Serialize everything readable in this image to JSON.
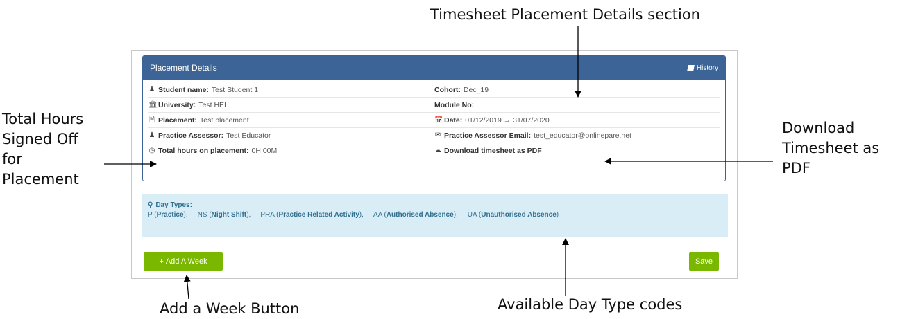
{
  "callouts": {
    "top": "Timesheet Placement Details section",
    "total_hours": [
      "Total Hours",
      "Signed Off",
      "for",
      "Placement"
    ],
    "download": [
      "Download",
      "Timesheet as",
      "PDF"
    ],
    "add_week": "Add a Week Button",
    "day_types": "Available Day Type codes"
  },
  "panel": {
    "title": "Placement Details",
    "history_label": "History",
    "rows": [
      {
        "left_icon": "user-icon",
        "left_label": "Student name:",
        "left_value": "Test Student 1",
        "right_label": "Cohort:",
        "right_value": "Dec_19"
      },
      {
        "left_icon": "university-icon",
        "left_label": "University:",
        "left_value": "Test HEI",
        "right_label": "Module No:",
        "right_value": ""
      },
      {
        "left_icon": "file-icon",
        "left_label": "Placement:",
        "left_value": "Test placement",
        "right_icon": "calendar-icon",
        "right_label": "Date:",
        "right_value": "01/12/2019 → 31/07/2020"
      },
      {
        "left_icon": "user-icon",
        "left_label": "Practice Assessor:",
        "left_value": "Test Educator",
        "right_icon": "envelope-icon",
        "right_label": "Practice Assessor Email:",
        "right_value": "test_educator@onlinepare.net"
      },
      {
        "left_icon": "clock-icon",
        "left_label": "Total hours on placement:",
        "left_value": "0H 00M",
        "right_icon": "cloud-download-icon",
        "right_label": "Download timesheet as PDF",
        "right_value": ""
      }
    ]
  },
  "day_types": {
    "title": "Day Types:",
    "items": [
      {
        "code": "P",
        "name": "Practice"
      },
      {
        "code": "NS",
        "name": "Night Shift"
      },
      {
        "code": "PRA",
        "name": "Practice Related Activity"
      },
      {
        "code": "AA",
        "name": "Authorised Absence"
      },
      {
        "code": "UA",
        "name": "Unauthorised Absence"
      }
    ]
  },
  "buttons": {
    "add_week": "Add A Week",
    "save": "Save"
  }
}
